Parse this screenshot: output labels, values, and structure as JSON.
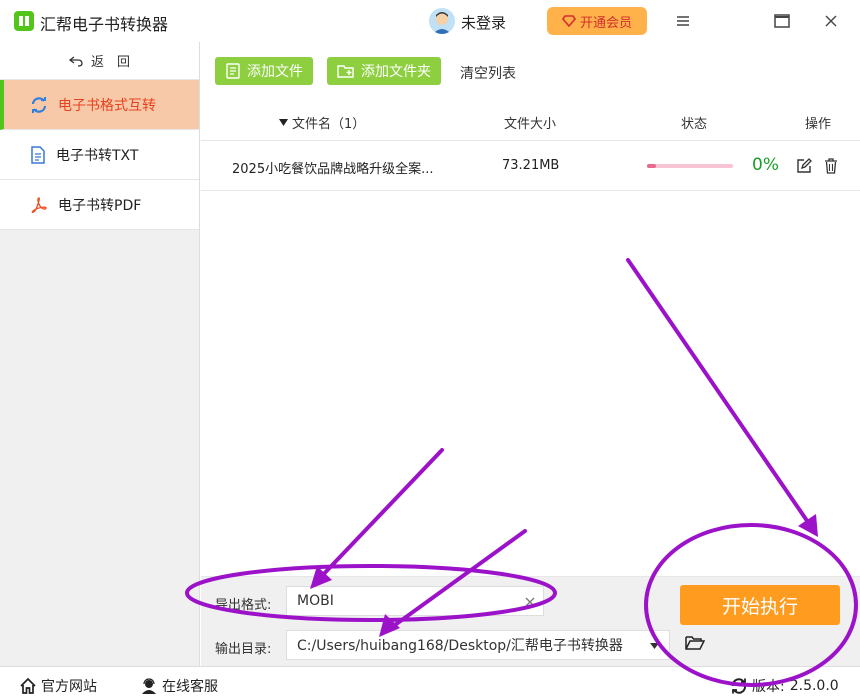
{
  "titlebar": {
    "title": "汇帮电子书转换器",
    "login": "未登录",
    "vip": "开通会员"
  },
  "sidebar": {
    "back_label": "返　回",
    "items": [
      {
        "label": "电子书格式互转",
        "icon": "refresh-icon",
        "active": true
      },
      {
        "label": "电子书转TXT",
        "icon": "document-icon",
        "active": false
      },
      {
        "label": "电子书转PDF",
        "icon": "pdf-icon",
        "active": false
      }
    ]
  },
  "toolbar": {
    "add_file": "添加文件",
    "add_folder": "添加文件夹",
    "clear": "清空列表"
  },
  "table": {
    "headers": {
      "name": "文件名（1）",
      "size": "文件大小",
      "status": "状态",
      "action": "操作"
    },
    "rows": [
      {
        "name": "2025小吃餐饮品牌战略升级全案...",
        "size": "73.21MB",
        "progress": 0.1,
        "percent": "0%"
      }
    ]
  },
  "bottom": {
    "format_label": "导出格式:",
    "format_value": "MOBI",
    "dir_label": "输出目录:",
    "dir_value": "C:/Users/huibang168/Desktop/汇帮电子书转换器",
    "start": "开始执行"
  },
  "statusbar": {
    "website": "官方网站",
    "service": "在线客服",
    "version_label": "版本:",
    "version": "2.5.0.0"
  },
  "colors": {
    "accent_green": "#8dcf3f",
    "active_bg": "#f8c9a8",
    "active_text": "#e8411f",
    "start_orange": "#ff9c1f",
    "annotation_purple": "#9b12c9"
  }
}
